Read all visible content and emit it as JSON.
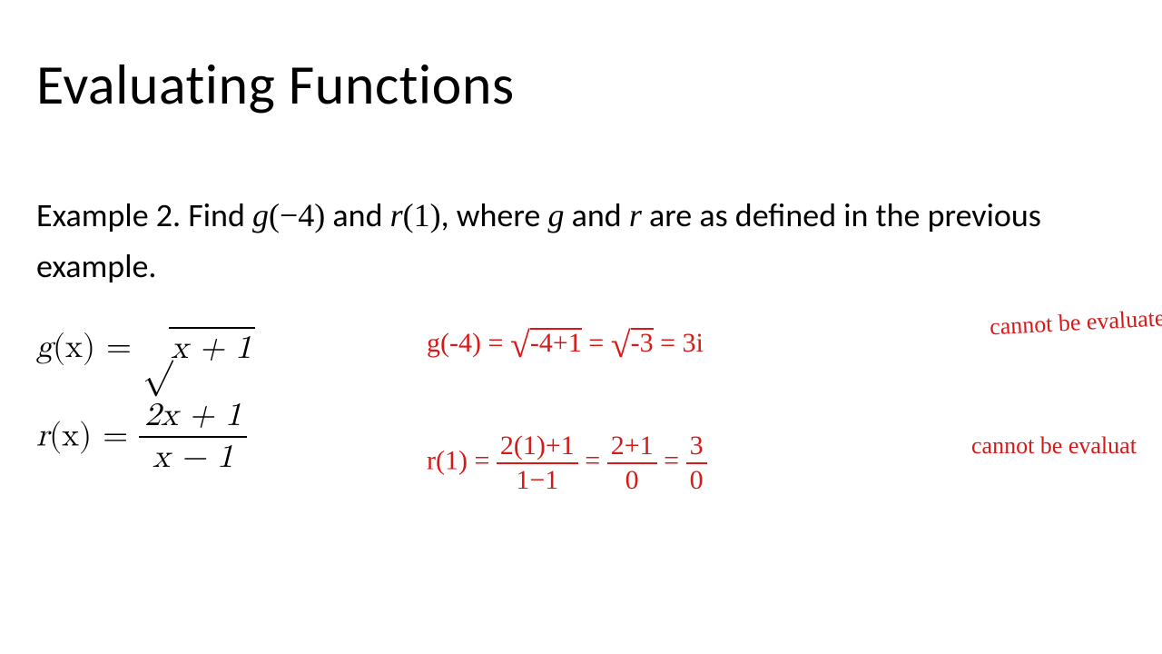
{
  "title": "Evaluating Functions",
  "example": {
    "prefix": "Example 2. Find ",
    "g_call": "g",
    "g_arg": "(−4)",
    "and": " and ",
    "r_call": "r",
    "r_arg": "(1)",
    "mid": ", where ",
    "g_var": "g",
    "and2": " and ",
    "r_var": "r",
    "suffix": " are as defined in the previous example."
  },
  "formula_g": {
    "lhs_fn": "g",
    "lhs_arg": "(x) = ",
    "sqrt_sym": "√",
    "sqrt_body": "x + 1"
  },
  "formula_r": {
    "lhs_fn": "r",
    "lhs_arg": "(x) = ",
    "num": "2x + 1",
    "den": "x − 1"
  },
  "work_g": {
    "lhs": "g(-4) = ",
    "sq1": "√",
    "body1": "-4+1",
    "eq1": " = ",
    "sq2": "√",
    "body2": "-3",
    "eq2": " = 3i",
    "note": "cannot be evaluated"
  },
  "work_r": {
    "lhs": "r(1) = ",
    "n1": "2(1)+1",
    "d1": "1−1",
    "eq1": " = ",
    "n2": "2+1",
    "d2": "0",
    "eq2": " = ",
    "n3": "3",
    "d3": "0",
    "note": "cannot be evaluat"
  }
}
